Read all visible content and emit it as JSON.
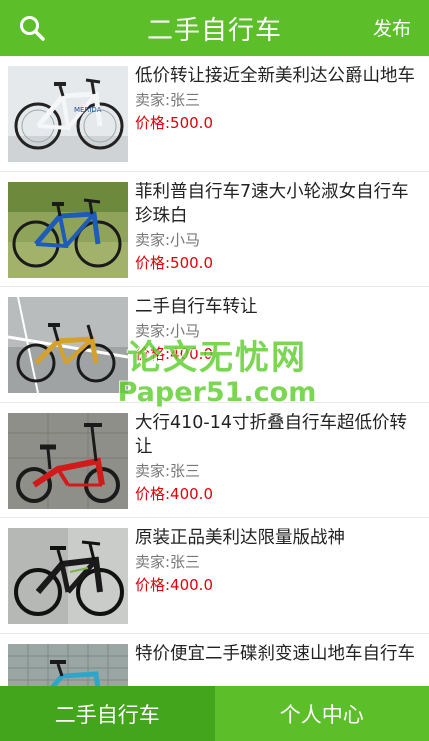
{
  "header": {
    "title": "二手自行车",
    "publish_label": "发布",
    "search_icon": "search-icon"
  },
  "listings": [
    {
      "title": "低价转让接近全新美利达公爵山地车",
      "seller": "卖家:张三",
      "price": "价格:500.0"
    },
    {
      "title": "菲利普自行车7速大小轮淑女自行车珍珠白",
      "seller": "卖家:小马",
      "price": "价格:500.0"
    },
    {
      "title": "二手自行车转让",
      "seller": "卖家:小马",
      "price": "价格:400.0"
    },
    {
      "title": "大行410-14寸折叠自行车超低价转让",
      "seller": "卖家:张三",
      "price": "价格:400.0"
    },
    {
      "title": "原装正品美利达限量版战神",
      "seller": "卖家:张三",
      "price": "价格:400.0"
    },
    {
      "title": "特价便宜二手碟刹变速山地车自行车",
      "seller": "",
      "price": ""
    }
  ],
  "watermark": {
    "line1": "论文无忧网",
    "line2": "Paper51.com"
  },
  "tabs": [
    {
      "label": "二手自行车",
      "active": true
    },
    {
      "label": "个人中心",
      "active": false
    }
  ],
  "colors": {
    "brand_green": "#5cbf2a",
    "active_tab_green": "#43a51c",
    "price_red": "#e0000a"
  }
}
